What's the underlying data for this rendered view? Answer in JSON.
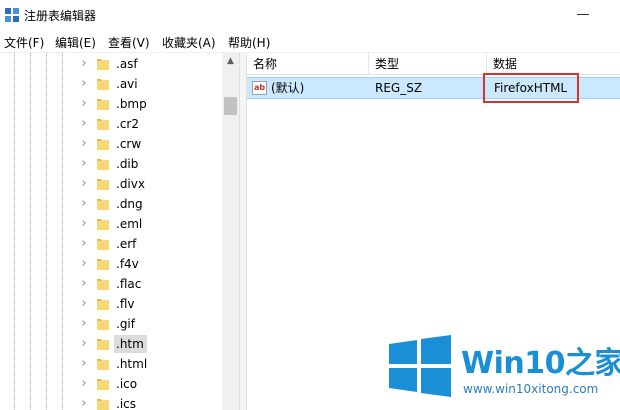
{
  "window": {
    "title": "注册表编辑器"
  },
  "menu": [
    {
      "label": "文件(F)"
    },
    {
      "label": "编辑(E)"
    },
    {
      "label": "查看(V)"
    },
    {
      "label": "收藏夹(A)"
    },
    {
      "label": "帮助(H)"
    }
  ],
  "tree": {
    "items": [
      {
        "label": ".asf"
      },
      {
        "label": ".avi"
      },
      {
        "label": ".bmp"
      },
      {
        "label": ".cr2"
      },
      {
        "label": ".crw"
      },
      {
        "label": ".dib"
      },
      {
        "label": ".divx"
      },
      {
        "label": ".dng"
      },
      {
        "label": ".eml"
      },
      {
        "label": ".erf"
      },
      {
        "label": ".f4v"
      },
      {
        "label": ".flac"
      },
      {
        "label": ".flv"
      },
      {
        "label": ".gif"
      },
      {
        "label": ".htm",
        "selected": true
      },
      {
        "label": ".html"
      },
      {
        "label": ".ico"
      },
      {
        "label": ".ics"
      }
    ]
  },
  "list": {
    "columns": [
      {
        "label": "名称"
      },
      {
        "label": "类型"
      },
      {
        "label": "数据"
      }
    ],
    "rows": [
      {
        "name": "(默认)",
        "type": "REG_SZ",
        "data": "FirefoxHTML"
      }
    ]
  },
  "watermark": {
    "title_main": "Win10",
    "title_suffix": "之家",
    "url": "www.win10xitong.com"
  },
  "colors": {
    "selection": "#cce8ff",
    "highlight_box": "#d03434",
    "folder": "#f7d774",
    "watermark": "#1b8fd6"
  }
}
